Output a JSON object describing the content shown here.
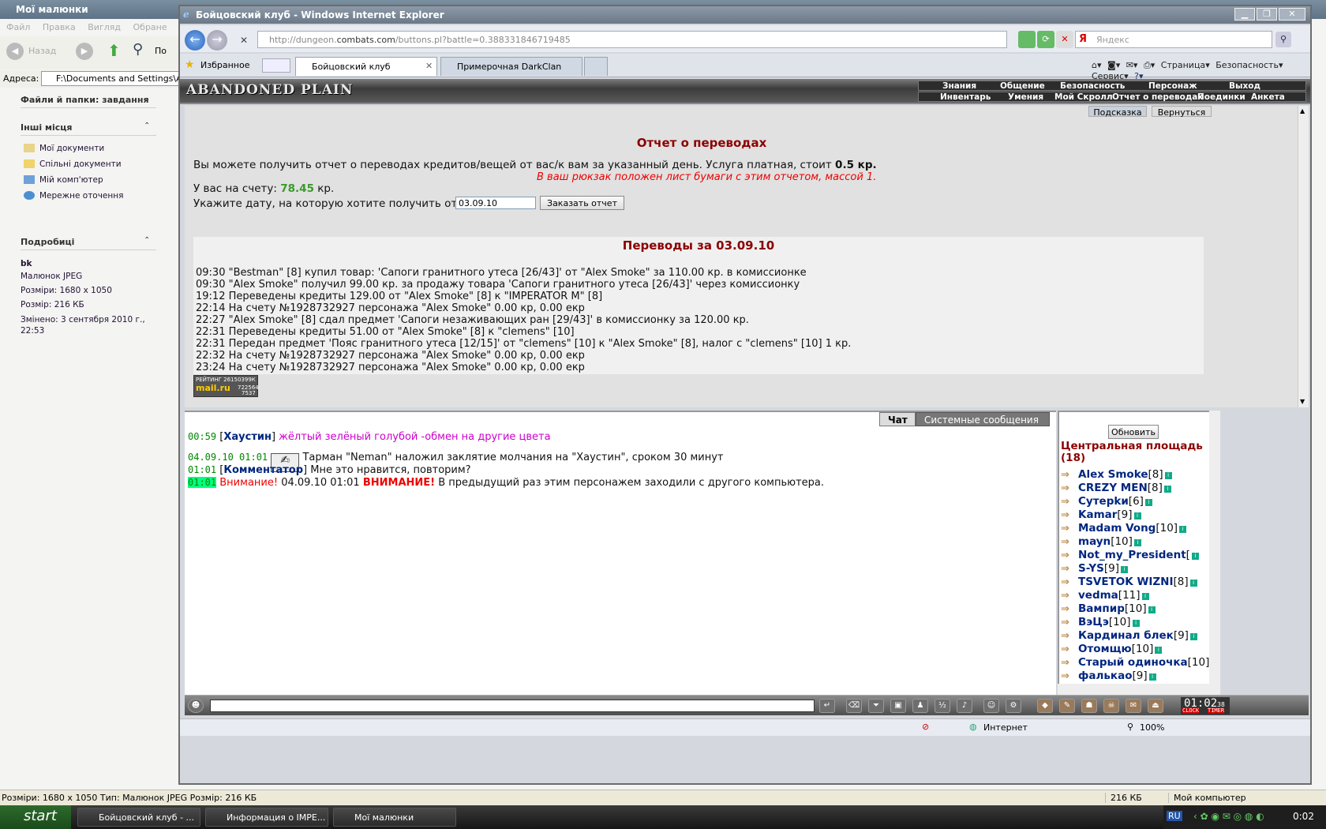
{
  "explorer": {
    "title": "Мої малюнки",
    "menu": [
      "Файл",
      "Правка",
      "Вигляд",
      "Обране"
    ],
    "back_label": "Назад",
    "search_label": "По",
    "address_label": "Адреса:",
    "address_value": "F:\\Documents and Settings\\A",
    "tasks_header": "Файли й папки: завдання",
    "places_header": "Інші місця",
    "places": [
      "Мої документи",
      "Спільні документи",
      "Мій комп'ютер",
      "Мережне оточення"
    ],
    "details_header": "Подробиці",
    "details_name": "bk",
    "details_lines": [
      "Малюнок JPEG",
      "Розміри: 1680 x 1050",
      "Розмір: 216 КБ",
      "Змінено: 3 сентября 2010 г.,",
      "22:53"
    ],
    "status_text": "Розміри: 1680 x 1050 Тип: Малюнок JPEG Розмір: 216 КБ",
    "status_size": "216 КБ",
    "status_computer": "Мой компьютер"
  },
  "taskbar": {
    "start_label": "start",
    "buttons": [
      "Бойцовский клуб - ...",
      "Информация о IMPE...",
      "Мої малюнки"
    ],
    "lang": "RU",
    "time": "0:02"
  },
  "ie": {
    "title": "Бойцовский клуб - Windows Internet Explorer",
    "url_pre": "http://dungeon.",
    "url_domain": "combats.com",
    "url_post": "/buttons.pl?battle=0.388331846719485",
    "search_placeholder": "Яндекс",
    "favorites_label": "Избранное",
    "tabs": [
      "Бойцовский клуб",
      "Примерочная DarkClan"
    ],
    "commands": [
      "Страница",
      "Безопасность",
      "Сервис"
    ],
    "status_zone": "Интернет",
    "zoom": "100%"
  },
  "game": {
    "logo": "ABANDONED PLAIN",
    "menu_top": [
      "Знания",
      "Общение",
      "Безопасность",
      "Персонаж",
      "Выход"
    ],
    "menu_bottom": [
      "Инвентарь",
      "Умения",
      "Мой Скролл",
      "Отчет о переводах",
      "Поединки",
      "Анкета"
    ],
    "hint_button": "Подсказка",
    "back_button": "Вернуться",
    "report_title": "Отчет о переводах",
    "intro_text": "Вы можете получить отчет о переводах кредитов/вещей от вас/к вам за указанный день. Услуга платная, стоит",
    "intro_price": "0.5 кр.",
    "note": "В ваш рюкзак положен лист бумаги с этим отчетом, массой 1.",
    "balance_label": "У вас на счету:",
    "balance_value": "78.45",
    "balance_unit": "кр.",
    "date_label": "Укажите дату, на которую хотите получить отчет:",
    "date_value": "03.09.10",
    "order_button": "Заказать отчет",
    "transfers_title": "Переводы за 03.09.10",
    "transfers": [
      "09:30 \"Bestman\" [8] купил товар: 'Сапоги гранитного утеса [26/43]' от \"Alex Smoke\" за 110.00 кр. в комиссионке",
      "09:30 \"Alex Smoke\" получил 99.00 кр. за продажу товара 'Сапоги гранитного утеса [26/43]' через комиссионку",
      "19:12 Переведены кредиты 129.00 от \"Alex Smoke\" [8] к \"IMPERATOR M\" [8]",
      "22:14 На счету №1928732927 персонажа \"Alex Smoke\" 0.00 кр, 0.00 екр",
      "22:27 \"Alex Smoke\" [8] сдал предмет 'Сапоги незаживающих ран [29/43]' в комиссионку за 120.00 кр.",
      "22:31 Переведены кредиты 51.00 от \"Alex Smoke\" [8] к \"clemens\" [10]",
      "22:31 Передан предмет 'Пояс гранитного утеса [12/15]' от \"clemens\" [10] к \"Alex Smoke\" [8], налог с \"clemens\" [10] 1 кр.",
      "22:32 На счету №1928732927 персонажа \"Alex Smoke\" 0.00 кр, 0.00 екр",
      "23:24 На счету №1928732927 персонажа \"Alex Smoke\" 0.00 кр, 0.00 екр"
    ],
    "counter_line1": "РЕЙТИНГ 26150399К",
    "counter_brand": "mail.ru",
    "counter_n1": "722564",
    "counter_n2": "7537"
  },
  "chat": {
    "tab_chat": "Чат",
    "tab_system": "Системные сообщения",
    "lines": [
      {
        "time": "00:59",
        "nick": "Хаустин",
        "text": "жёлтый зелёный голубой -обмен на другие цвета"
      },
      {
        "time": "04.09.10 01:01",
        "text": "Тарман \"Neman\" наложил заклятие молчания на \"Хаустин\", сроком 30 минут"
      },
      {
        "time": "01:01",
        "nick": "Комментатор",
        "text": "Мне это нравится, повторим?"
      },
      {
        "time": "01:01",
        "warn": "Внимание!",
        "date": "04.09.10 01:01",
        "caps": "ВНИМАНИЕ!",
        "text": "В предыдущий раз этим персонажем заходили с другого компьютера."
      }
    ]
  },
  "online": {
    "refresh": "Обновить",
    "area": "Центральная площадь (18)",
    "users": [
      {
        "name": "Alex Smoke",
        "lvl": "[8]"
      },
      {
        "name": "CREZY MEN",
        "lvl": "[8]"
      },
      {
        "name": "Cyтерkи",
        "lvl": "[6]"
      },
      {
        "name": "Kamar",
        "lvl": "[9]"
      },
      {
        "name": "Madam Vong",
        "lvl": "[10]"
      },
      {
        "name": "mayn",
        "lvl": "[10]"
      },
      {
        "name": "Not_my_President",
        "lvl": "["
      },
      {
        "name": "S-YS",
        "lvl": "[9]"
      },
      {
        "name": "TSVETOK WIZNI",
        "lvl": "[8]"
      },
      {
        "name": "vedma",
        "lvl": "[11]"
      },
      {
        "name": "Вампир",
        "lvl": "[10]"
      },
      {
        "name": "ВэЦэ",
        "lvl": "[10]"
      },
      {
        "name": "Кардинал блек",
        "lvl": "[9]"
      },
      {
        "name": "Отомщю",
        "lvl": "[10]"
      },
      {
        "name": "Старый одиночка",
        "lvl": "[10]"
      },
      {
        "name": "фалькао",
        "lvl": "[9]"
      }
    ]
  },
  "clock": {
    "time": "01:02",
    "sec": "38",
    "label1": "CLOCK",
    "label2": "TIMER"
  }
}
